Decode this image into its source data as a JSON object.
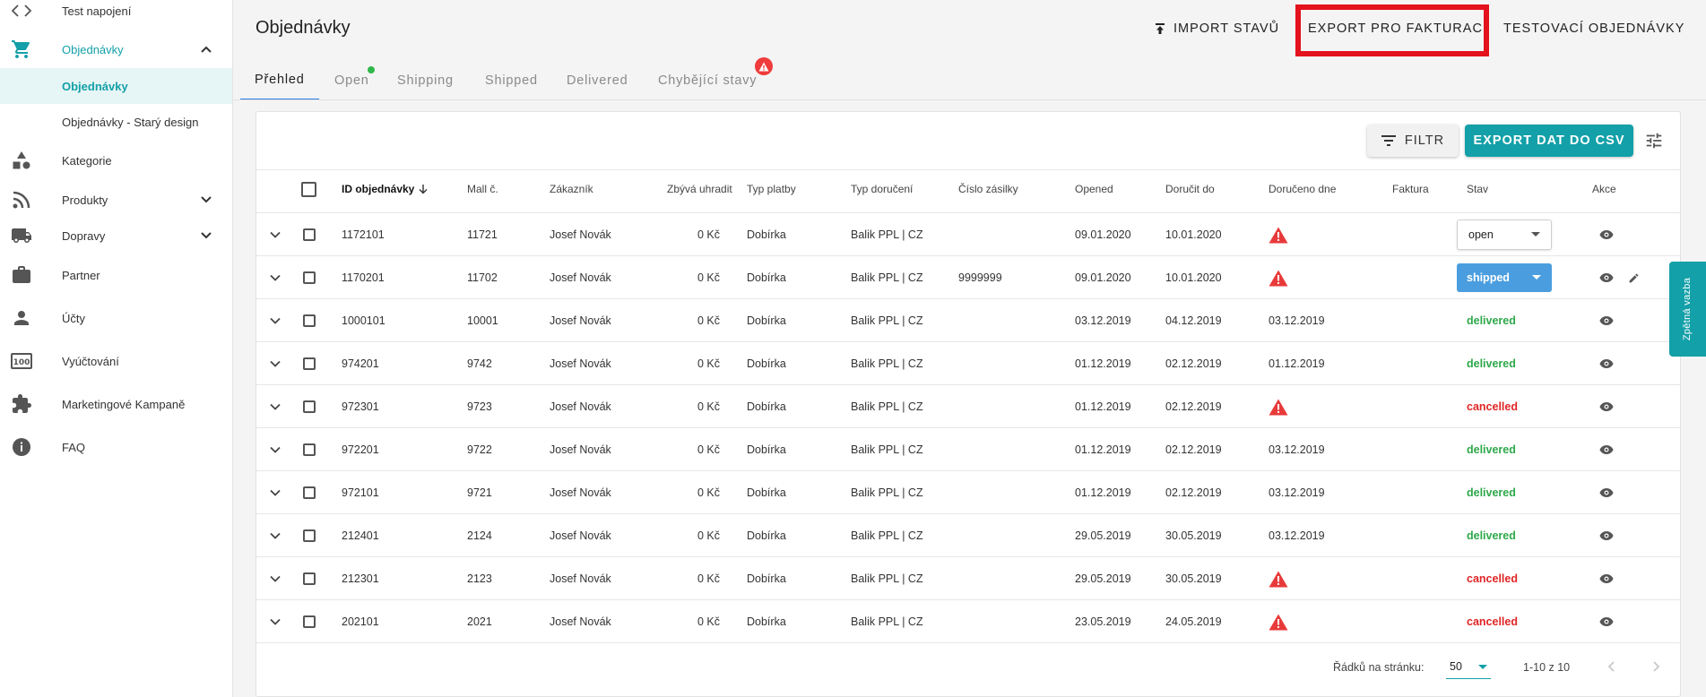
{
  "sidebar": {
    "top_item": "Test napojení",
    "orders": "Objednávky",
    "orders_sub": "Objednávky",
    "orders_old": "Objednávky - Starý design",
    "categories": "Kategorie",
    "products": "Produkty",
    "shipping": "Dopravy",
    "partner": "Partner",
    "accounts": "Účty",
    "billing": "Vyúčtování",
    "campaigns": "Marketingové Kampaně",
    "faq": "FAQ",
    "accent_color": "#13a0a8"
  },
  "header": {
    "title": "Objednávky",
    "import_label": "IMPORT STAVŮ",
    "export_invoice_label": "EXPORT PRO FAKTURACI",
    "test_orders_label": "TESTOVACÍ OBJEDNÁVKY"
  },
  "tabs": [
    "Přehled",
    "Open",
    "Shipping",
    "Shipped",
    "Delivered",
    "Chybějící stavy"
  ],
  "toolbar": {
    "filter_label": "FILTR",
    "csv_label": "EXPORT DAT DO CSV"
  },
  "columns": [
    "ID objednávky",
    "Mall č.",
    "Zákazník",
    "Zbývá uhradit",
    "Typ platby",
    "Typ doručení",
    "Číslo zásilky",
    "Opened",
    "Doručit do",
    "Doručeno dne",
    "Faktura",
    "Stav",
    "Akce"
  ],
  "rows": [
    {
      "id": "1172101",
      "mall": "11721",
      "customer": "Josef Novák",
      "remaining": "0 Kč",
      "payment": "Dobírka",
      "delivery": "Balik PPL | CZ",
      "tracking": "",
      "opened": "09.01.2020",
      "due": "10.01.2020",
      "delivered_on": "",
      "state": "open"
    },
    {
      "id": "1170201",
      "mall": "11702",
      "customer": "Josef Novák",
      "remaining": "0 Kč",
      "payment": "Dobírka",
      "delivery": "Balik PPL | CZ",
      "tracking": "9999999",
      "opened": "09.01.2020",
      "due": "10.01.2020",
      "delivered_on": "",
      "state": "shipped"
    },
    {
      "id": "1000101",
      "mall": "10001",
      "customer": "Josef Novák",
      "remaining": "0 Kč",
      "payment": "Dobírka",
      "delivery": "Balik PPL | CZ",
      "tracking": "",
      "opened": "03.12.2019",
      "due": "04.12.2019",
      "delivered_on": "03.12.2019",
      "state": "delivered"
    },
    {
      "id": "974201",
      "mall": "9742",
      "customer": "Josef Novák",
      "remaining": "0 Kč",
      "payment": "Dobírka",
      "delivery": "Balik PPL | CZ",
      "tracking": "",
      "opened": "01.12.2019",
      "due": "02.12.2019",
      "delivered_on": "01.12.2019",
      "state": "delivered"
    },
    {
      "id": "972301",
      "mall": "9723",
      "customer": "Josef Novák",
      "remaining": "0 Kč",
      "payment": "Dobírka",
      "delivery": "Balik PPL | CZ",
      "tracking": "",
      "opened": "01.12.2019",
      "due": "02.12.2019",
      "delivered_on": "",
      "state": "cancelled"
    },
    {
      "id": "972201",
      "mall": "9722",
      "customer": "Josef Novák",
      "remaining": "0 Kč",
      "payment": "Dobírka",
      "delivery": "Balik PPL | CZ",
      "tracking": "",
      "opened": "01.12.2019",
      "due": "02.12.2019",
      "delivered_on": "03.12.2019",
      "state": "delivered"
    },
    {
      "id": "972101",
      "mall": "9721",
      "customer": "Josef Novák",
      "remaining": "0 Kč",
      "payment": "Dobírka",
      "delivery": "Balik PPL | CZ",
      "tracking": "",
      "opened": "01.12.2019",
      "due": "02.12.2019",
      "delivered_on": "03.12.2019",
      "state": "delivered"
    },
    {
      "id": "212401",
      "mall": "2124",
      "customer": "Josef Novák",
      "remaining": "0 Kč",
      "payment": "Dobírka",
      "delivery": "Balik PPL | CZ",
      "tracking": "",
      "opened": "29.05.2019",
      "due": "30.05.2019",
      "delivered_on": "03.12.2019",
      "state": "delivered"
    },
    {
      "id": "212301",
      "mall": "2123",
      "customer": "Josef Novák",
      "remaining": "0 Kč",
      "payment": "Dobírka",
      "delivery": "Balik PPL | CZ",
      "tracking": "",
      "opened": "29.05.2019",
      "due": "30.05.2019",
      "delivered_on": "",
      "state": "cancelled"
    },
    {
      "id": "202101",
      "mall": "2021",
      "customer": "Josef Novák",
      "remaining": "0 Kč",
      "payment": "Dobírka",
      "delivery": "Balik PPL | CZ",
      "tracking": "",
      "opened": "23.05.2019",
      "due": "24.05.2019",
      "delivered_on": "",
      "state": "cancelled"
    }
  ],
  "footer": {
    "rows_per_page_label": "Řádků na stránku:",
    "rows_per_page": "50",
    "range": "1-10 z 10"
  },
  "feedback_label": "Zpětná vazba",
  "colors": {
    "delivered": "#2ea84a",
    "cancelled": "#e02525",
    "shipped": "#4a9ee0",
    "highlight": "#e3121d"
  }
}
